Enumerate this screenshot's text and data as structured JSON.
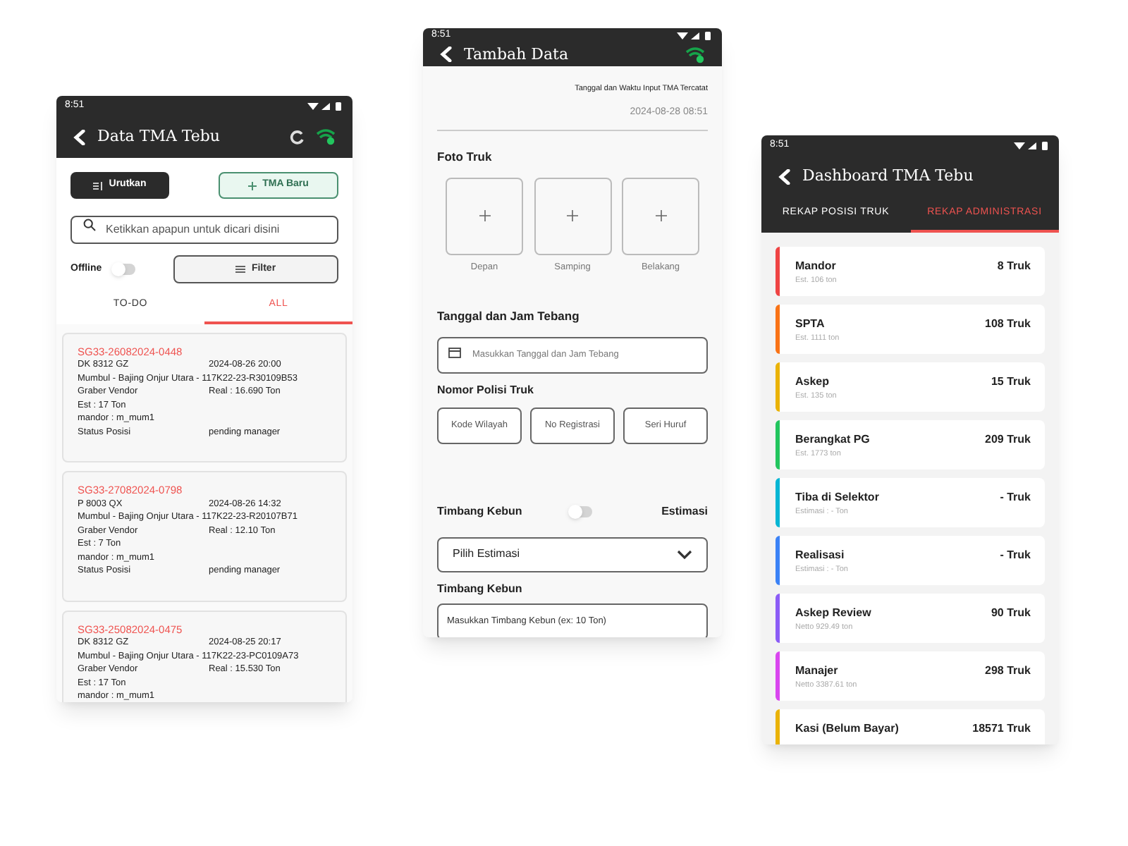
{
  "data_list": {
    "status_time": "8:51",
    "title": "Data TMA Tebu",
    "sort_button": "Urutkan",
    "new_button": "TMA Baru",
    "search": {
      "placeholder": "Ketikkan apapun untuk dicari disini"
    },
    "offline": {
      "label": "Offline",
      "on": false
    },
    "filter_button": "Filter",
    "tabs": [
      {
        "label": "TO-DO",
        "selected": false
      },
      {
        "label": "ALL",
        "selected": true
      }
    ],
    "records": [
      {
        "id": "SG33-26082024-0448",
        "plate": "DK 8312 GZ",
        "datetime": "2024-08-26 20:00",
        "route": "Mumbul - Bajing Onjur Utara - 117K22-23-R30109B53",
        "vendor": "Graber Vendor",
        "real": "Real : 16.690 Ton",
        "est": "Est : 17 Ton",
        "mandor": "mandor : m_mum1",
        "status_label": "Status Posisi",
        "status": "pending manager"
      },
      {
        "id": "SG33-27082024-0798",
        "plate": "P 8003 QX",
        "datetime": "2024-08-26 14:32",
        "route": "Mumbul - Bajing Onjur Utara - 117K22-23-R20107B71",
        "vendor": "Graber Vendor",
        "real": "Real : 12.10 Ton",
        "est": "Est : 7 Ton",
        "mandor": "mandor : m_mum1",
        "status_label": "Status Posisi",
        "status": "pending manager"
      },
      {
        "id": "SG33-25082024-0475",
        "plate": "DK 8312 GZ",
        "datetime": "2024-08-25 20:17",
        "route": "Mumbul - Bajing Onjur Utara - 117K22-23-PC0109A73",
        "vendor": "Graber Vendor",
        "real": "Real : 15.530 Ton",
        "est": "Est : 17 Ton",
        "mandor": "mandor : m_mum1"
      }
    ]
  },
  "add_form": {
    "status_time": "8:51",
    "title": "Tambah Data",
    "timestamp_label": "Tanggal dan Waktu Input TMA Tercatat",
    "timestamp": "2024-08-28 08:51",
    "photo_heading": "Foto Truk",
    "photos": [
      {
        "label": "Depan"
      },
      {
        "label": "Samping"
      },
      {
        "label": "Belakang"
      }
    ],
    "date_heading": "Tanggal dan Jam Tebang",
    "date_field": {
      "placeholder": "Masukkan Tanggal dan Jam Tebang"
    },
    "plate_heading": "Nomor Polisi Truk",
    "plate_fields": [
      {
        "placeholder": "Kode Wilayah"
      },
      {
        "placeholder": "No Registrasi"
      },
      {
        "placeholder": "Seri Huruf"
      }
    ],
    "weigh_toggle": {
      "label": "Timbang Kebun",
      "on": false,
      "right_label": "Estimasi"
    },
    "estimate_select": "Pilih Estimasi",
    "weigh_heading": "Timbang Kebun",
    "weigh_field": {
      "placeholder": "Masukkan Timbang Kebun (ex: 10 Ton)"
    }
  },
  "dashboard": {
    "status_time": "8:51",
    "title": "Dashboard TMA Tebu",
    "tabs": [
      {
        "label": "REKAP POSISI TRUK",
        "selected": false
      },
      {
        "label": "REKAP ADMINISTRASI",
        "selected": true
      }
    ],
    "stages": [
      {
        "name": "Mandor",
        "note": "Est. 106 ton",
        "count": "8 Truk",
        "color": "#ef4444"
      },
      {
        "name": "SPTA",
        "note": "Est. 1111 ton",
        "count": "108 Truk",
        "color": "#f97316"
      },
      {
        "name": "Askep",
        "note": "Est. 135 ton",
        "count": "15 Truk",
        "color": "#eab308"
      },
      {
        "name": "Berangkat PG",
        "note": "Est. 1773 ton",
        "count": "209 Truk",
        "color": "#22c55e"
      },
      {
        "name": "Tiba di Selektor",
        "note": "Estimasi : - Ton",
        "count": "- Truk",
        "color": "#06b6d4"
      },
      {
        "name": "Realisasi",
        "note": "Estimasi : - Ton",
        "count": "- Truk",
        "color": "#3b82f6"
      },
      {
        "name": "Askep Review",
        "note": "Netto 929.49 ton",
        "count": "90 Truk",
        "color": "#8b5cf6"
      },
      {
        "name": "Manajer",
        "note": "Netto 3387.61 ton",
        "count": "298 Truk",
        "color": "#d946ef"
      },
      {
        "name": "Kasi (Belum Bayar)",
        "count": "18571 Truk",
        "color": "#eab308"
      }
    ]
  }
}
